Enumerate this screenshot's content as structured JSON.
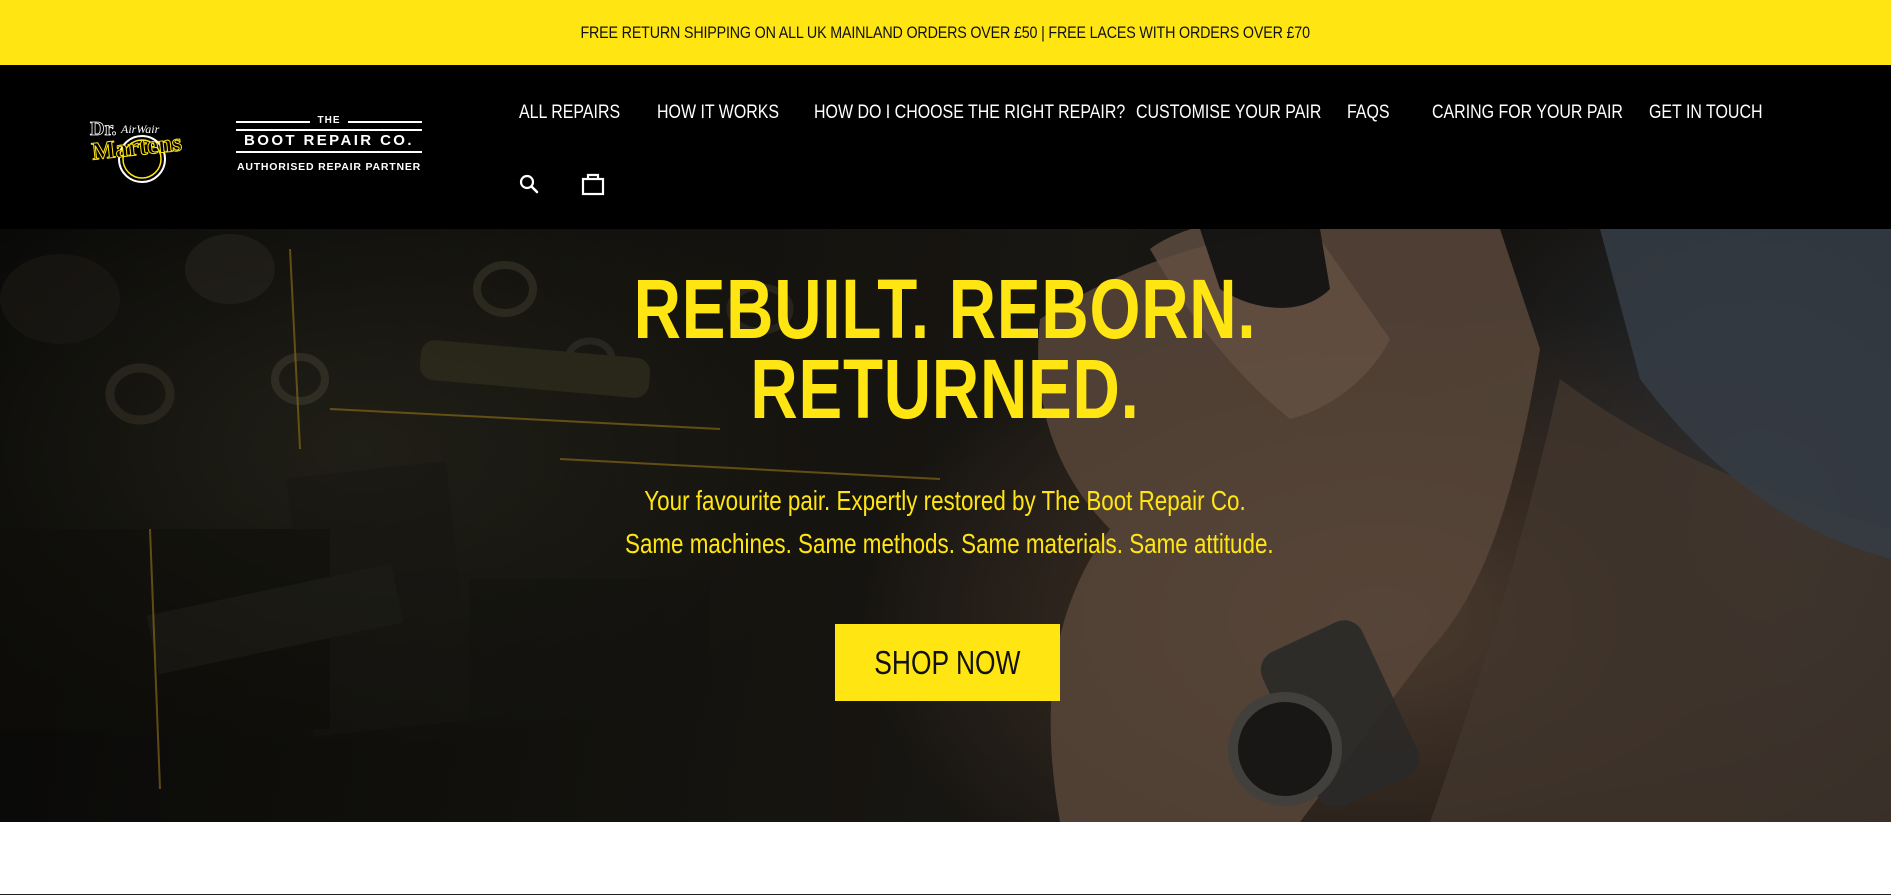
{
  "announcement": {
    "text": "FREE RETURN SHIPPING ON ALL UK MAINLAND ORDERS OVER £50 | FREE LACES WITH ORDERS OVER £70"
  },
  "header": {
    "logo_drmartens": {
      "line1": "Dr.",
      "line2": "Martens",
      "script": "AirWair"
    },
    "logo_brc": {
      "the": "THE",
      "name": "BOOT REPAIR CO.",
      "tagline": "AUTHORISED REPAIR PARTNER"
    },
    "nav": [
      {
        "label": "ALL REPAIRS"
      },
      {
        "label": "HOW IT WORKS"
      },
      {
        "label": "HOW DO I CHOOSE THE RIGHT REPAIR?"
      },
      {
        "label": "CUSTOMISE YOUR PAIR"
      },
      {
        "label": "FAQS"
      },
      {
        "label": "CARING FOR YOUR PAIR"
      },
      {
        "label": "GET IN TOUCH"
      }
    ],
    "icons": [
      "search-icon",
      "cart-icon"
    ]
  },
  "hero": {
    "title_line1": "REBUILT. REBORN.",
    "title_line2": "RETURNED.",
    "subtitle_line1": "Your favourite pair. Expertly restored by The Boot Repair Co.",
    "subtitle_line2": "Same machines. Same methods. Same materials. Same attitude.",
    "cta": "SHOP NOW"
  },
  "colors": {
    "brand_yellow": "#ffe512",
    "header_black": "#000000",
    "text_dark": "#111111"
  }
}
